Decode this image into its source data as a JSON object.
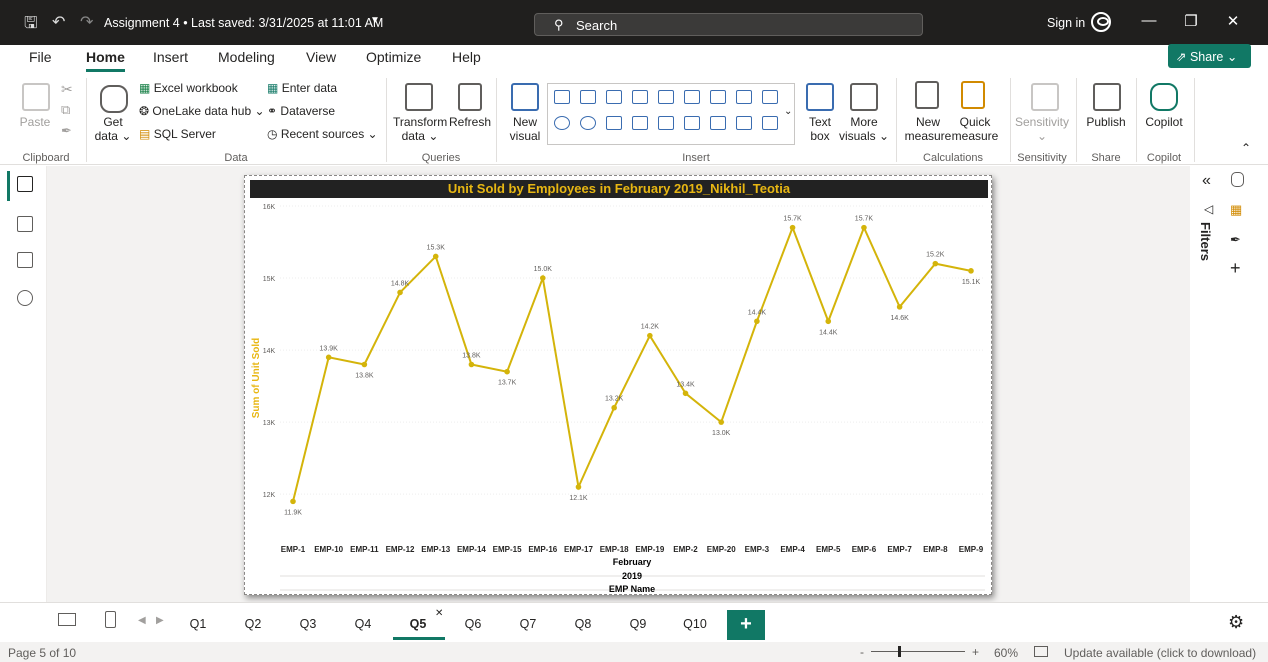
{
  "titlebar": {
    "title": "Assignment 4 • Last saved: 3/31/2025 at 11:01 AM",
    "search_placeholder": "Search",
    "sign_in": "Sign in"
  },
  "menu": {
    "tabs": [
      "File",
      "Home",
      "Insert",
      "Modeling",
      "View",
      "Optimize",
      "Help"
    ],
    "active": "Home",
    "share_label": "Share"
  },
  "ribbon": {
    "paste": "Paste",
    "get_data": [
      "Get",
      "data"
    ],
    "excel_workbook": "Excel workbook",
    "onelake": "OneLake data hub",
    "sql_server": "SQL Server",
    "enter_data": "Enter data",
    "dataverse": "Dataverse",
    "recent_sources": "Recent sources",
    "transform": [
      "Transform",
      "data"
    ],
    "refresh": "Refresh",
    "new_visual": [
      "New",
      "visual"
    ],
    "text_box": [
      "Text",
      "box"
    ],
    "more_visuals": [
      "More",
      "visuals"
    ],
    "new_measure": [
      "New",
      "measure"
    ],
    "quick_measure": [
      "Quick",
      "measure"
    ],
    "sensitivity": "Sensitivity",
    "publish": "Publish",
    "copilot": "Copilot",
    "groups": {
      "clipboard": "Clipboard",
      "data": "Data",
      "queries": "Queries",
      "insert": "Insert",
      "calculations": "Calculations",
      "sensitivity": "Sensitivity",
      "share": "Share",
      "copilot": "Copilot"
    }
  },
  "right_pane": {
    "filters": "Filters"
  },
  "pages": {
    "tabs": [
      "Q1",
      "Q2",
      "Q3",
      "Q4",
      "Q5",
      "Q6",
      "Q7",
      "Q8",
      "Q9",
      "Q10"
    ],
    "active": "Q5",
    "add": "+"
  },
  "status": {
    "page": "Page 5 of 10",
    "zoom": "60%",
    "zoom_minus": "-",
    "zoom_plus": "+",
    "update": "Update available (click to download)"
  },
  "colors": {
    "accent": "#117865",
    "line": "#D4B40A",
    "title_text": "#E8B713",
    "title_bg": "#222222"
  },
  "chart_data": {
    "type": "line",
    "title": "Unit Sold by Employees in February 2019_Nikhil_Teotia",
    "ylabel": "Sum of Unit Sold",
    "xlabel": "EMP Name",
    "x_group_labels": [
      "February",
      "2019"
    ],
    "ylim": [
      11600,
      16000
    ],
    "yticks": [
      12000,
      13000,
      14000,
      15000,
      16000
    ],
    "ytick_labels": [
      "12K",
      "13K",
      "14K",
      "15K",
      "16K"
    ],
    "grid": true,
    "categories": [
      "EMP-1",
      "EMP-10",
      "EMP-11",
      "EMP-12",
      "EMP-13",
      "EMP-14",
      "EMP-15",
      "EMP-16",
      "EMP-17",
      "EMP-18",
      "EMP-19",
      "EMP-2",
      "EMP-20",
      "EMP-3",
      "EMP-4",
      "EMP-5",
      "EMP-6",
      "EMP-7",
      "EMP-8",
      "EMP-9"
    ],
    "values": [
      11900,
      13900,
      13800,
      14800,
      15300,
      13800,
      13700,
      15000,
      12100,
      13200,
      14200,
      13400,
      13000,
      14400,
      15700,
      14400,
      15700,
      14600,
      15200,
      15100
    ],
    "data_labels": [
      "11.9K",
      "13.9K",
      "13.8K",
      "14.8K",
      "15.3K",
      "13.8K",
      "13.7K",
      "15.0K",
      "12.1K",
      "13.2K",
      "14.2K",
      "13.4K",
      "13.0K",
      "14.4K",
      "15.7K",
      "14.4K",
      "15.7K",
      "14.6K",
      "15.2K",
      "15.1K"
    ]
  }
}
